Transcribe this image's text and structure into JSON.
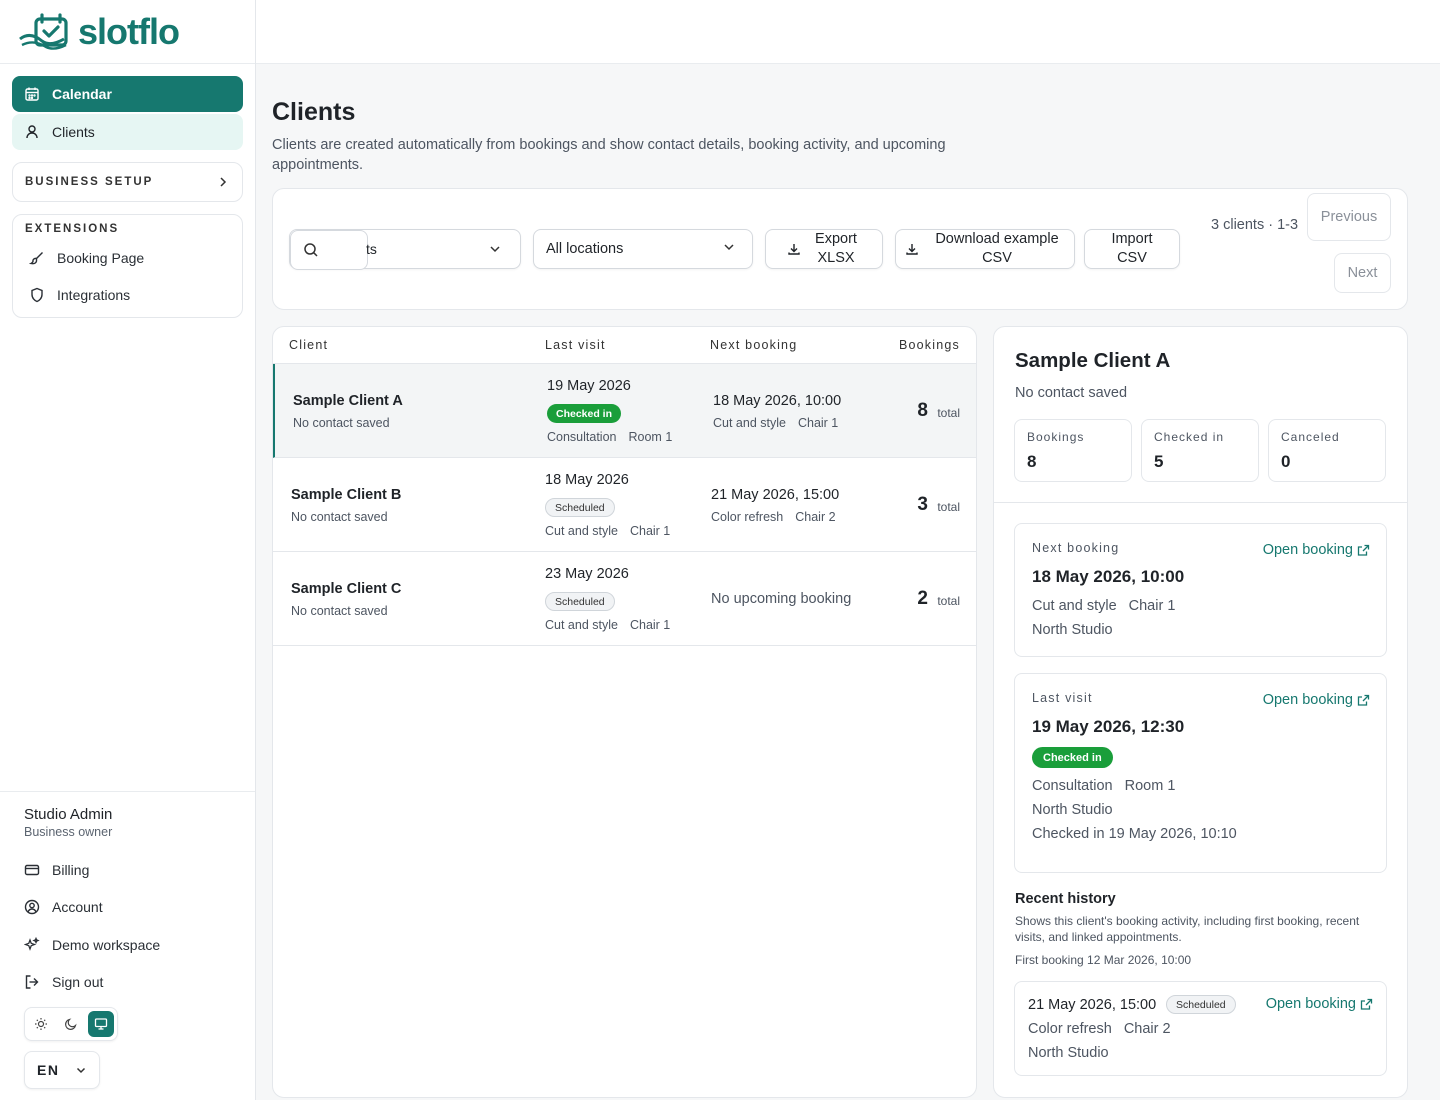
{
  "app": {
    "name": "slotflo",
    "brand_color": "#16786f",
    "success_color": "#1a9e3a"
  },
  "sidebar": {
    "nav": [
      {
        "label": "Calendar",
        "icon": "calendar-icon",
        "active": true
      },
      {
        "label": "Clients",
        "icon": "user-icon"
      }
    ],
    "business_setup": "BUSINESS SETUP",
    "extensions_title": "EXTENSIONS",
    "extensions": [
      {
        "label": "Booking Page",
        "icon": "brush-icon"
      },
      {
        "label": "Integrations",
        "icon": "shield-icon"
      }
    ],
    "user": {
      "name": "Studio Admin",
      "role": "Business owner"
    },
    "links": [
      {
        "label": "Billing",
        "icon": "credit-card-icon"
      },
      {
        "label": "Account",
        "icon": "user-circle-icon"
      },
      {
        "label": "Demo workspace",
        "icon": "sparkles-icon"
      },
      {
        "label": "Sign out",
        "icon": "sign-out-icon"
      }
    ],
    "theme_options": [
      "sun-icon",
      "moon-icon",
      "monitor-icon"
    ],
    "language": "EN"
  },
  "page": {
    "title": "Clients",
    "description": "Clients are created automatically from bookings and show contact details, booking activity, and upcoming appointments."
  },
  "toolbar": {
    "search_value": "ts",
    "location_select": "All locations",
    "export_label": "Export XLSX",
    "download_label": "Download example CSV",
    "import_label": "Import CSV",
    "count_text": "3 clients · 1-3",
    "previous": "Previous",
    "next": "Next"
  },
  "table": {
    "columns": [
      "Client",
      "Last visit",
      "Next booking",
      "Bookings"
    ],
    "total_suffix": "total",
    "rows": [
      {
        "name": "Sample Client A",
        "contact": "No contact saved",
        "last_visit": "19 May 2026",
        "status": "Checked in",
        "last_service": "Consultation",
        "last_resource": "Room 1",
        "next_booking": "18 May 2026, 10:00",
        "next_service": "Cut and style",
        "next_resource": "Chair 1",
        "bookings": "8"
      },
      {
        "name": "Sample Client B",
        "contact": "No contact saved",
        "last_visit": "18 May 2026",
        "status": "Scheduled",
        "last_service": "Cut and style",
        "last_resource": "Chair 1",
        "next_booking": "21 May 2026, 15:00",
        "next_service": "Color refresh",
        "next_resource": "Chair 2",
        "bookings": "3"
      },
      {
        "name": "Sample Client C",
        "contact": "No contact saved",
        "last_visit": "23 May 2026",
        "status": "Scheduled",
        "last_service": "Cut and style",
        "last_resource": "Chair 1",
        "next_booking": "No upcoming booking",
        "next_service": "",
        "next_resource": "",
        "bookings": "2"
      }
    ]
  },
  "detail": {
    "name": "Sample Client A",
    "contact": "No contact saved",
    "stats": [
      {
        "label": "Bookings",
        "value": "8"
      },
      {
        "label": "Checked in",
        "value": "5"
      },
      {
        "label": "Canceled",
        "value": "0"
      }
    ],
    "open_booking": "Open booking",
    "next": {
      "label": "Next booking",
      "datetime": "18 May 2026, 10:00",
      "service": "Cut and style",
      "resource": "Chair 1",
      "location": "North Studio"
    },
    "last": {
      "label": "Last visit",
      "datetime": "19 May 2026, 12:30",
      "status": "Checked in",
      "service": "Consultation",
      "resource": "Room 1",
      "location": "North Studio",
      "checked_in": "Checked in 19 May 2026, 10:10"
    },
    "recent_history": {
      "title": "Recent history",
      "description": "Shows this client's booking activity, including first booking, recent visits, and linked appointments.",
      "first_booking": "First booking 12 Mar 2026, 10:00",
      "item": {
        "datetime": "21 May 2026, 15:00",
        "status": "Scheduled",
        "service": "Color refresh",
        "resource": "Chair 2",
        "location": "North Studio"
      }
    }
  }
}
